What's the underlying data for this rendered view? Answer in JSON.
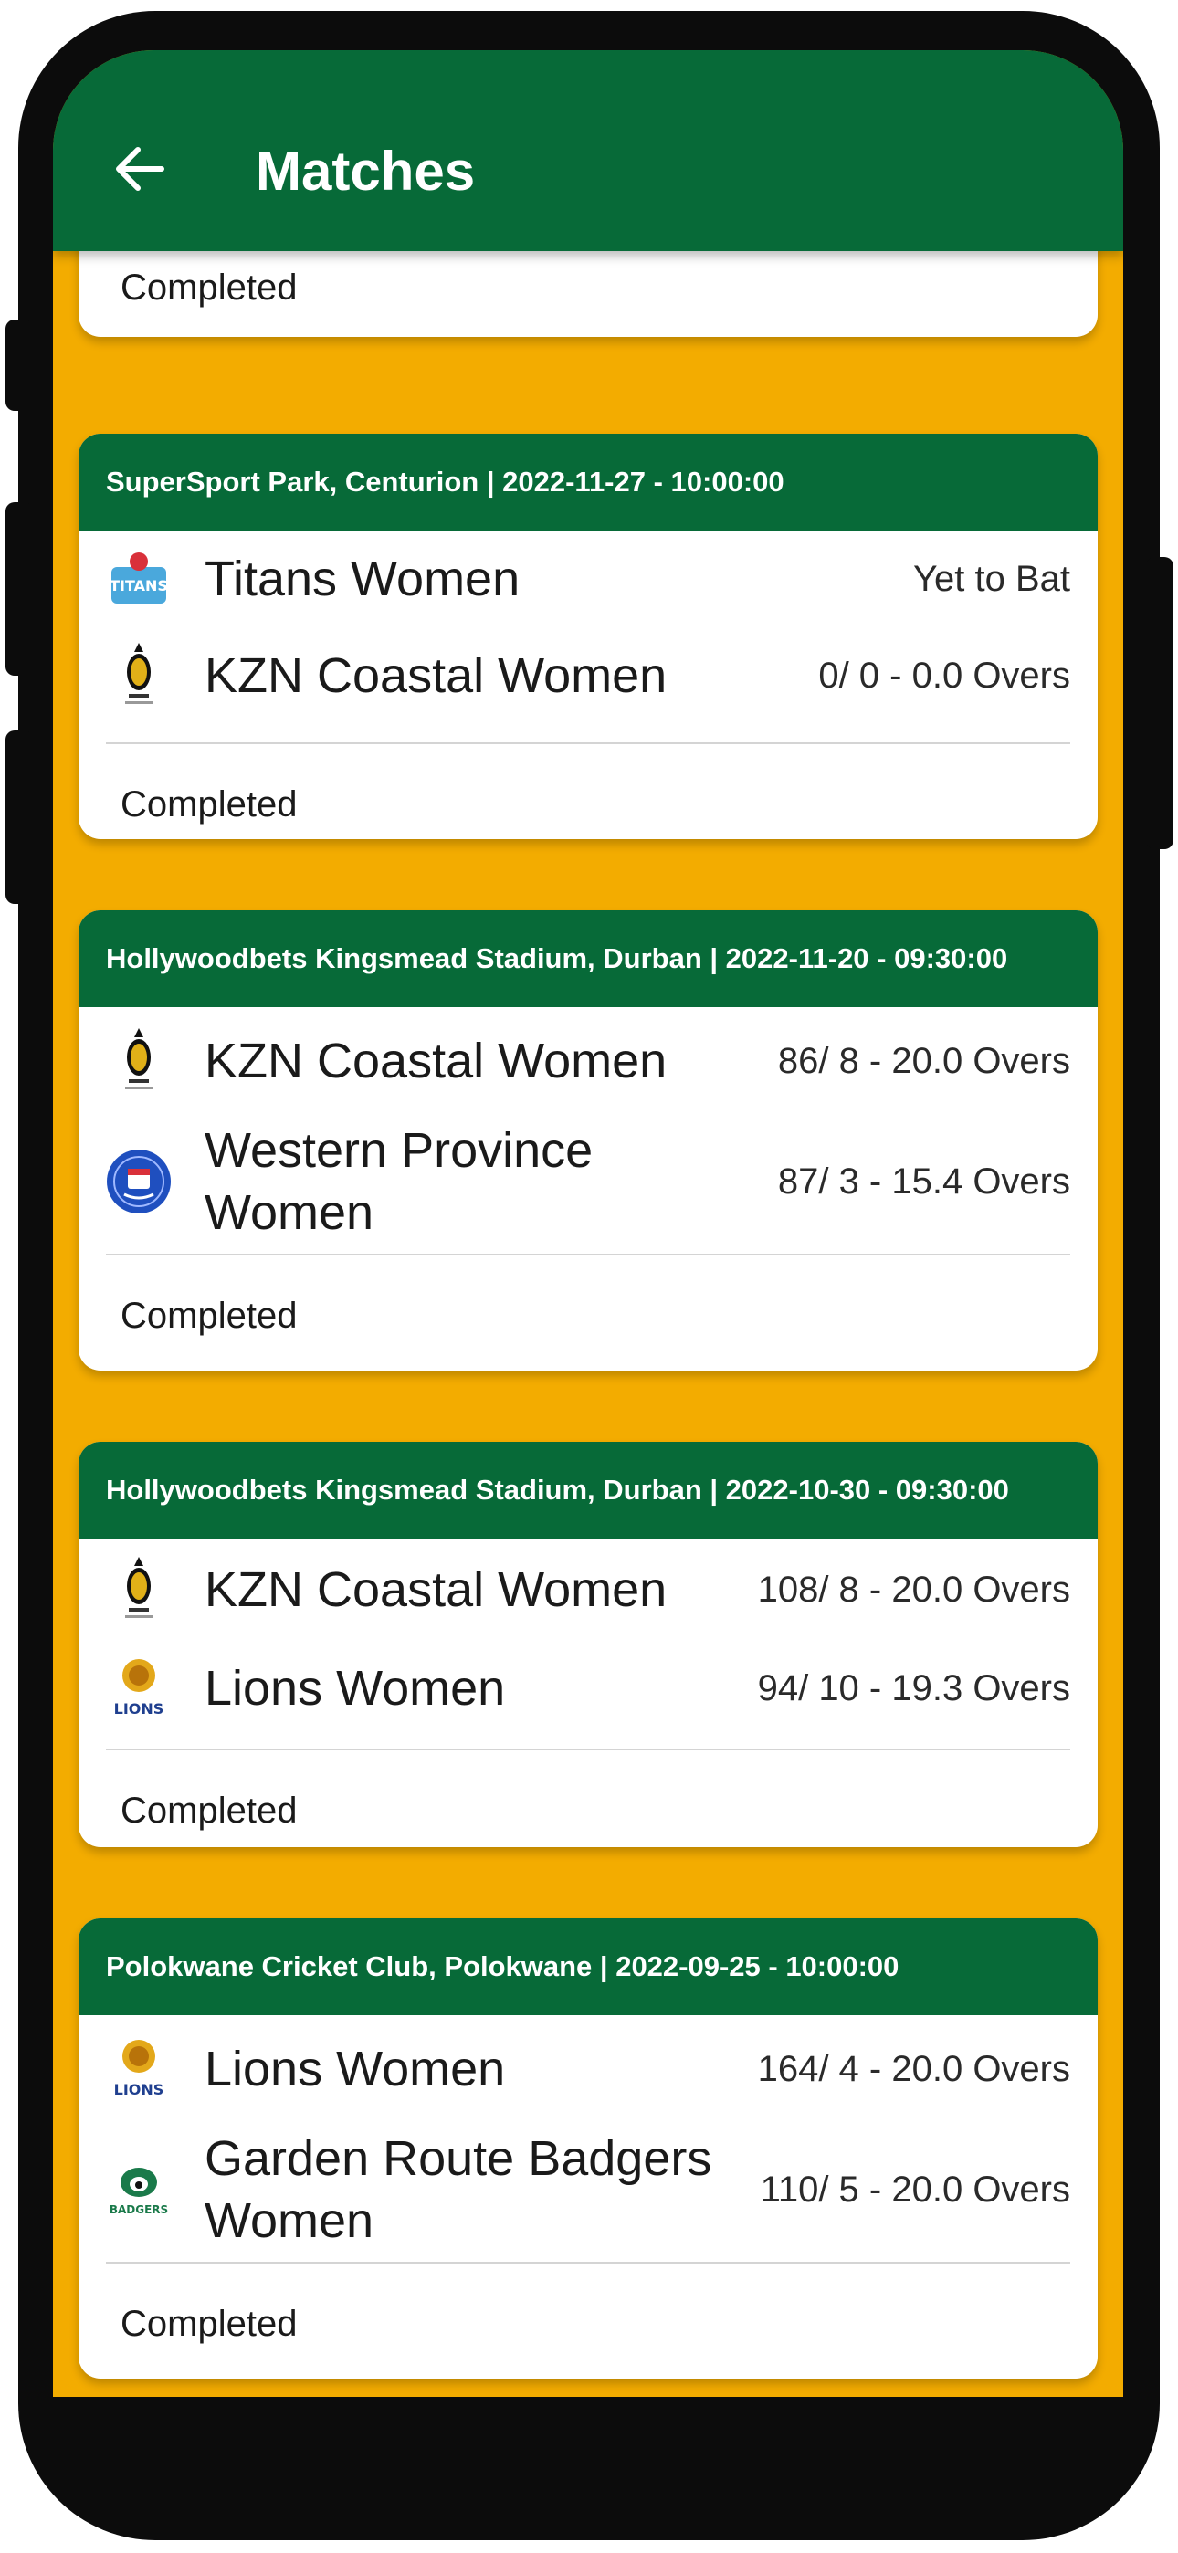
{
  "app_bar": {
    "title": "Matches"
  },
  "partial_card": {
    "status": "Completed"
  },
  "matches": [
    {
      "header": "SuperSport Park, Centurion | 2022-11-27 - 10:00:00",
      "teams": [
        {
          "name": "Titans Women",
          "score": "Yet to Bat",
          "logo": "titans-logo"
        },
        {
          "name": "KZN Coastal Women",
          "score": "0/ 0 - 0.0 Overs",
          "logo": "kzn-coastal-logo"
        }
      ],
      "status": "Completed"
    },
    {
      "header": "Hollywoodbets Kingsmead Stadium, Durban | 2022-11-20 - 09:30:00",
      "teams": [
        {
          "name": "KZN Coastal Women",
          "score": "86/ 8 - 20.0 Overs",
          "logo": "kzn-coastal-logo"
        },
        {
          "name": "Western Province Women",
          "score": "87/ 3 - 15.4 Overs",
          "logo": "western-province-logo"
        }
      ],
      "status": "Completed"
    },
    {
      "header": "Hollywoodbets Kingsmead Stadium, Durban | 2022-10-30 - 09:30:00",
      "teams": [
        {
          "name": "KZN Coastal Women",
          "score": "108/ 8 - 20.0 Overs",
          "logo": "kzn-coastal-logo"
        },
        {
          "name": "Lions Women",
          "score": "94/ 10 - 19.3 Overs",
          "logo": "lions-logo"
        }
      ],
      "status": "Completed"
    },
    {
      "header": "Polokwane Cricket Club, Polokwane | 2022-09-25 - 10:00:00",
      "teams": [
        {
          "name": "Lions Women",
          "score": "164/ 4 - 20.0 Overs",
          "logo": "lions-logo"
        },
        {
          "name": "Garden Route Badgers Women",
          "score": "110/ 5 - 20.0 Overs",
          "logo": "garden-route-badgers-logo"
        }
      ],
      "status": "Completed"
    }
  ],
  "colors": {
    "app_bar": "#076a38",
    "background": "#f3ac00",
    "card": "#ffffff"
  }
}
